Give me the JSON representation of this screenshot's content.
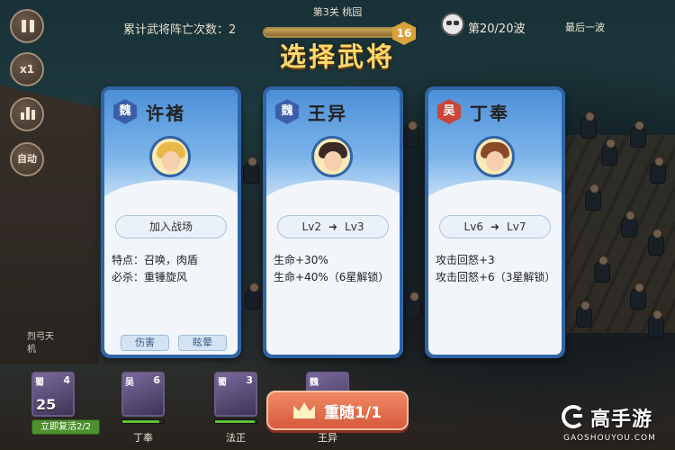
{
  "header": {
    "stage": "第3关 桃园",
    "death_count": "累计武将阵亡次数：2",
    "wave_badge": "16",
    "wave_text": "第20/20波",
    "last_wave": "最后一波",
    "wave_progress": 1.0
  },
  "controls": {
    "speed_label": "x1",
    "auto_label": "自动"
  },
  "title": "选择武将",
  "cards": [
    {
      "kingdom": "魏",
      "kingdom_color": "#3a5fa8",
      "name": "许褚",
      "action": "加入战场",
      "details": [
        "特点：召唤，肉盾",
        "必杀：重锤旋风"
      ],
      "tags": [
        "伤害",
        "眩晕"
      ],
      "portrait_hair": "#e8b84a"
    },
    {
      "kingdom": "魏",
      "kingdom_color": "#3a5fa8",
      "name": "王异",
      "level_from": "Lv2",
      "level_to": "Lv3",
      "details": [
        "生命+30%",
        "生命+40%（6星解锁）"
      ],
      "portrait_hair": "#3a2a26"
    },
    {
      "kingdom": "吴",
      "kingdom_color": "#c8463a",
      "name": "丁奉",
      "level_from": "Lv6",
      "level_to": "Lv7",
      "details": [
        "攻击回怒+3",
        "攻击回怒+6（3星解锁）"
      ],
      "portrait_hair": "#8a4a2a"
    }
  ],
  "bottom": {
    "side_text": "烈弓天机",
    "revive_count": "25",
    "revive_label": "立即复活2/2",
    "slots": [
      {
        "kingdom": "蜀",
        "num": "4",
        "name": ""
      },
      {
        "kingdom": "吴",
        "num": "6",
        "name": "丁奉"
      },
      {
        "kingdom": "蜀",
        "num": "3",
        "name": "法正"
      },
      {
        "kingdom": "魏",
        "num": "",
        "name": "王异"
      }
    ],
    "follow_label": "重随1/1"
  },
  "watermark": {
    "name": "高手游",
    "url": "GAOSHOUYOU.COM"
  },
  "colors": {
    "title": "#ffd86a",
    "card_frame": "#2f64a6",
    "follow_button": "#e07050"
  }
}
